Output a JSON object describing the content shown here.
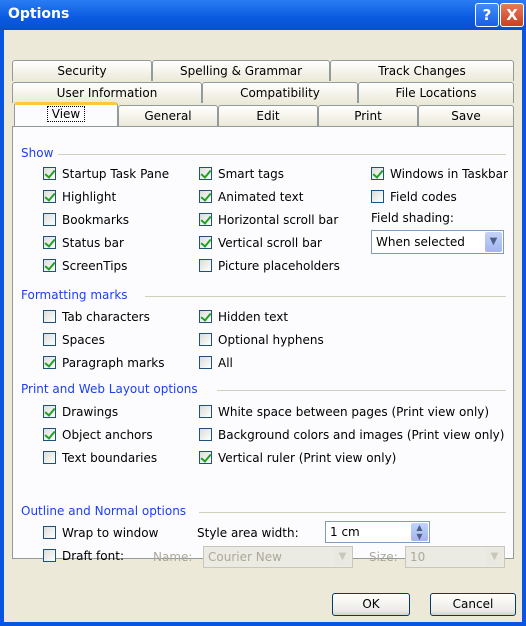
{
  "window": {
    "title": "Options",
    "help_glyph": "?",
    "close_glyph": "X"
  },
  "tabs": {
    "row1": [
      "Security",
      "Spelling & Grammar",
      "Track Changes"
    ],
    "row2": [
      "User Information",
      "Compatibility",
      "File Locations"
    ],
    "row3": [
      "View",
      "General",
      "Edit",
      "Print",
      "Save"
    ]
  },
  "show": {
    "heading": "Show",
    "startup_task_pane": "Startup Task Pane",
    "highlight": "Highlight",
    "bookmarks": "Bookmarks",
    "status_bar": "Status bar",
    "screentips": "ScreenTips",
    "smart_tags": "Smart tags",
    "animated_text": "Animated text",
    "horizontal_scroll_bar": "Horizontal scroll bar",
    "vertical_scroll_bar": "Vertical scroll bar",
    "picture_placeholders": "Picture placeholders",
    "windows_in_taskbar": "Windows in Taskbar",
    "field_codes": "Field codes",
    "field_shading_label": "Field shading:",
    "field_shading_value": "When selected"
  },
  "formatting": {
    "heading": "Formatting marks",
    "tab_characters": "Tab characters",
    "spaces": "Spaces",
    "paragraph_marks": "Paragraph marks",
    "hidden_text": "Hidden text",
    "optional_hyphens": "Optional hyphens",
    "all": "All"
  },
  "print_web": {
    "heading": "Print and Web Layout options",
    "drawings": "Drawings",
    "object_anchors": "Object anchors",
    "text_boundaries": "Text boundaries",
    "white_space": "White space between pages (Print view only)",
    "background_colors": "Background colors and images (Print view only)",
    "vertical_ruler": "Vertical ruler (Print view only)"
  },
  "outline": {
    "heading": "Outline and Normal options",
    "wrap_to_window": "Wrap to window",
    "draft_font": "Draft font:",
    "style_area_label": "Style area width:",
    "style_area_value": "1 cm",
    "name_label": "Name:",
    "name_value": "Courier New",
    "size_label": "Size:",
    "size_value": "10"
  },
  "buttons": {
    "ok": "OK",
    "cancel": "Cancel"
  },
  "colors": {
    "title_bar": "#0a5ae0",
    "group_heading": "#1c3ff2",
    "dialog_bg": "#ece9d8"
  }
}
